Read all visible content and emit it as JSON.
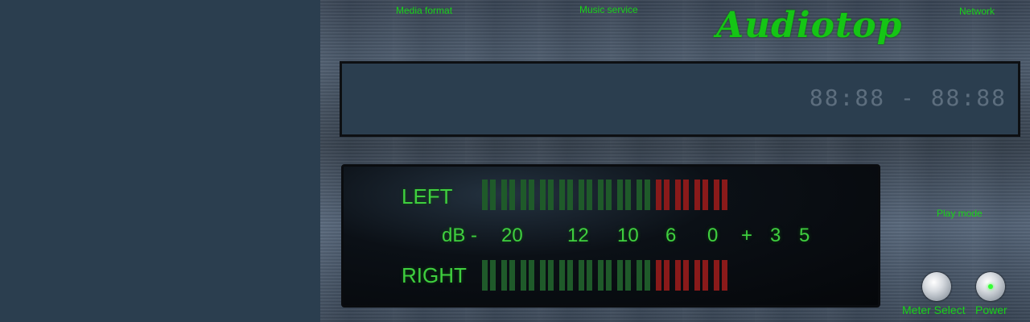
{
  "top_labels": {
    "media_format": "Media format",
    "music_service": "Music service",
    "network": "Network",
    "play_mode": "Play mode"
  },
  "brand": {
    "logo_text": "Audiotop"
  },
  "display": {
    "time_text": "88:88 - 88:88"
  },
  "meter": {
    "left_label": "LEFT",
    "right_label": "RIGHT",
    "scale_prefix": "dB -",
    "scale_values": [
      "20",
      "12",
      "10",
      "6",
      "0",
      "+",
      "3",
      "5"
    ],
    "segment_count": 26,
    "green_segments": 18,
    "colors": {
      "green_off": "#1f5a2a",
      "red_off": "#8a1a1a"
    }
  },
  "controls": {
    "meter_select": "Meter Select",
    "power": "Power"
  }
}
